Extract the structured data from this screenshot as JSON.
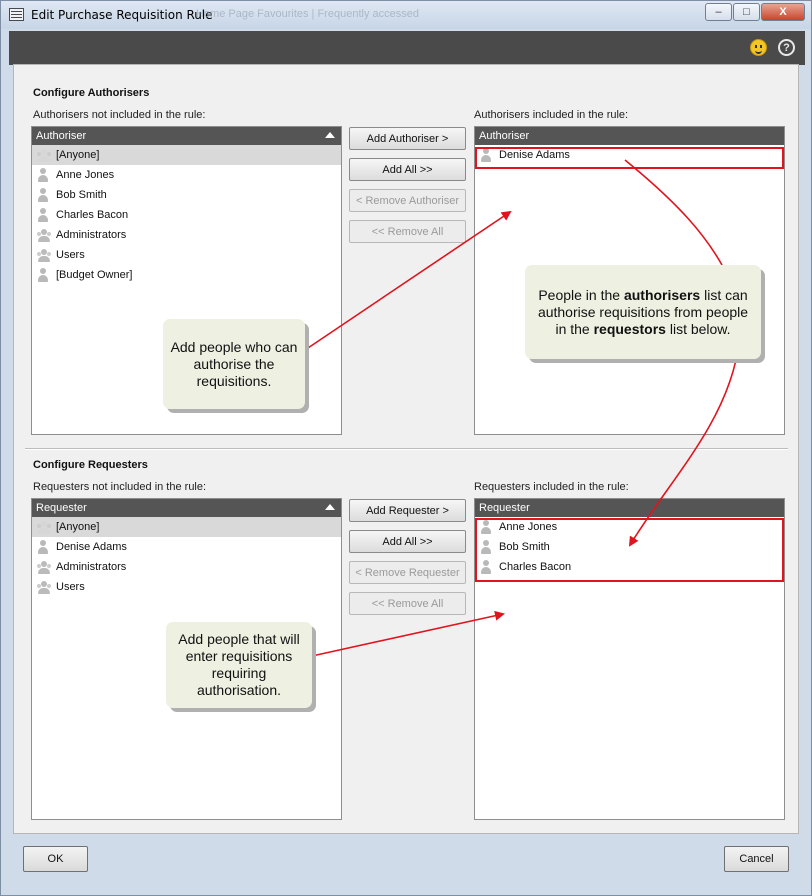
{
  "window": {
    "title": "Edit Purchase Requisition Rule",
    "ghost_tabs": "Home Page Favourites   |   Frequently accessed",
    "minimize": "–",
    "maximize": "□",
    "close": "X"
  },
  "topbar": {
    "smiley_icon": "smiley-icon",
    "help_icon": "?"
  },
  "authorisers": {
    "section_title": "Configure Authorisers",
    "available_caption": "Authorisers not included in the rule:",
    "included_caption": "Authorisers included in the rule:",
    "available_header": "Authoriser",
    "included_header": "Authoriser",
    "available": [
      "[Anyone]",
      "Anne Jones",
      "Bob Smith",
      "Charles Bacon",
      "Administrators",
      "Users",
      "[Budget Owner]"
    ],
    "included": [
      "Denise Adams"
    ],
    "buttons": {
      "add": "Add Authoriser >",
      "add_all": "Add All >>",
      "remove": "< Remove Authoriser",
      "remove_all": "<< Remove All"
    },
    "callout_left": "Add people who can authorise the requisitions."
  },
  "requesters": {
    "section_title": "Configure Requesters",
    "available_caption": "Requesters not included in the rule:",
    "included_caption": "Requesters included in the rule:",
    "available_header": "Requester",
    "included_header": "Requester",
    "available": [
      "[Anyone]",
      "Denise Adams",
      "Administrators",
      "Users"
    ],
    "included": [
      "Anne Jones",
      "Bob Smith",
      "Charles Bacon"
    ],
    "buttons": {
      "add": "Add Requester >",
      "add_all": "Add All >>",
      "remove": "< Remove Requester",
      "remove_all": "<< Remove All"
    },
    "callout_left": "Add people that will enter requisitions requiring authorisation."
  },
  "callout_right": {
    "part1": "People in the ",
    "bold1": "authorisers",
    "part2": " list can authorise requisitions from people in the ",
    "bold2": "requestors",
    "part3": " list below."
  },
  "footer": {
    "ok": "OK",
    "cancel": "Cancel"
  },
  "colors": {
    "arrow": "#e0141e",
    "header": "#555555",
    "topbar": "#4a4a4a"
  }
}
